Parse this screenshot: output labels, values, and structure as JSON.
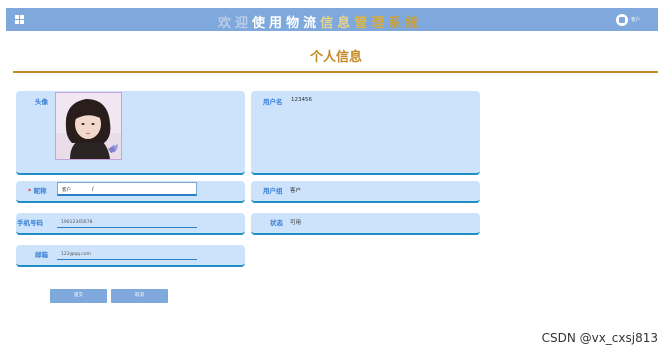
{
  "topbar": {
    "menu_icon": "grid-icon",
    "welcome_chars": [
      {
        "ch": "欢",
        "color": "#b9cde8"
      },
      {
        "ch": "迎",
        "color": "#b9cde8"
      },
      {
        "ch": "使",
        "color": "#ffffff"
      },
      {
        "ch": "用",
        "color": "#ffffff"
      },
      {
        "ch": "物",
        "color": "#ffffff"
      },
      {
        "ch": "流",
        "color": "#ffffff"
      },
      {
        "ch": "信",
        "color": "#e6d48e"
      },
      {
        "ch": "息",
        "color": "#e6d48e"
      },
      {
        "ch": "管",
        "color": "#e0b642"
      },
      {
        "ch": "理",
        "color": "#d9a93a"
      },
      {
        "ch": "系",
        "color": "#c9a03b"
      },
      {
        "ch": "统",
        "color": "#c9a03b"
      }
    ],
    "user_icon": "user-avatar-icon",
    "user_label": "客户"
  },
  "title": "个人信息",
  "form": {
    "avatar_label": "头像",
    "username_label": "用户名",
    "username_value": "123456",
    "nickname_label": "昵称",
    "nickname_required": "*",
    "nickname_value": "客户",
    "usergroup_label": "用户组",
    "usergroup_value": "客户",
    "phone_label": "手机号码",
    "phone_value": "19012345678",
    "status_label": "状态",
    "status_value": "可用",
    "email_label": "邮箱",
    "email_value": "123@qq.com"
  },
  "buttons": {
    "submit": "提交",
    "cancel": "取消"
  },
  "colors": {
    "topbar": "#7fa9dc",
    "title": "#c38a25",
    "card": "#cce3fb",
    "label": "#3a7fd5",
    "required": "#e2372e"
  },
  "watermark": "CSDN @vx_cxsj813"
}
